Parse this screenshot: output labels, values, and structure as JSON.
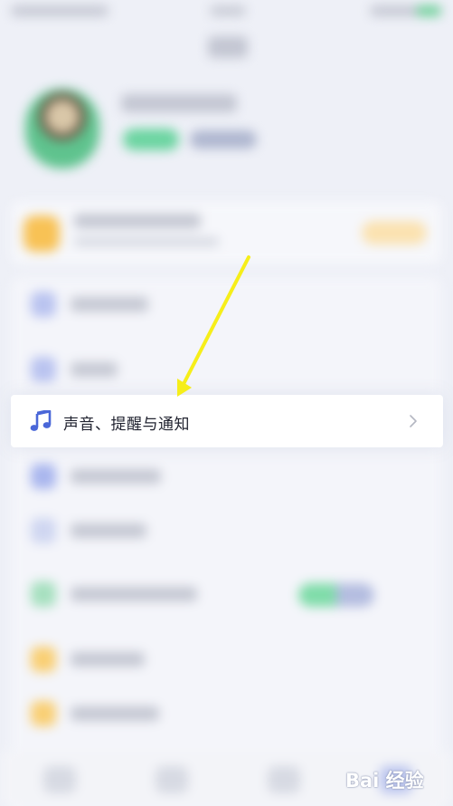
{
  "settings_list": {
    "highlighted_item": {
      "label": "声音、提醒与通知",
      "icon": "music-note-icon"
    }
  },
  "annotation": {
    "type": "arrow",
    "color": "#f6ee1a"
  },
  "watermark": {
    "text": "Bai 经验"
  },
  "colors": {
    "background": "#eef0f7",
    "accent_blue": "#4a67d8",
    "accent_green": "#6bd4a0",
    "accent_orange": "#f8c255"
  }
}
